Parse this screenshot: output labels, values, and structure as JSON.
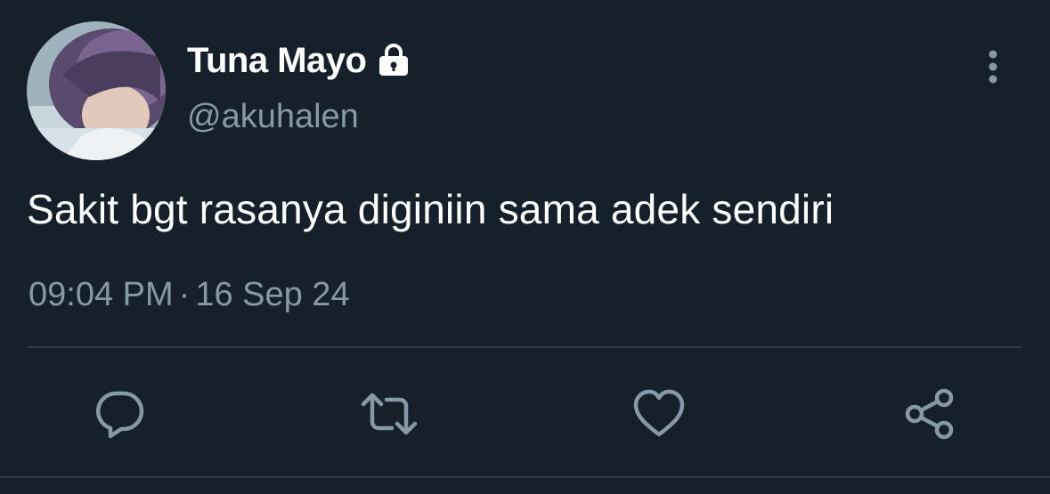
{
  "tweet": {
    "display_name": "Tuna Mayo",
    "handle": "@akuhalen",
    "protected_icon": "lock-icon",
    "text": "Sakit bgt rasanya diginiin sama adek sendiri",
    "time": "09:04 PM",
    "separator": "·",
    "date": "16 Sep 24"
  },
  "actions": {
    "reply_icon": "reply-icon",
    "retweet_icon": "retweet-icon",
    "like_icon": "heart-icon",
    "share_icon": "share-icon"
  },
  "colors": {
    "background": "#15202b",
    "primary_text": "#ffffff",
    "secondary_text": "#8899a6",
    "divider": "#2f3b47"
  }
}
